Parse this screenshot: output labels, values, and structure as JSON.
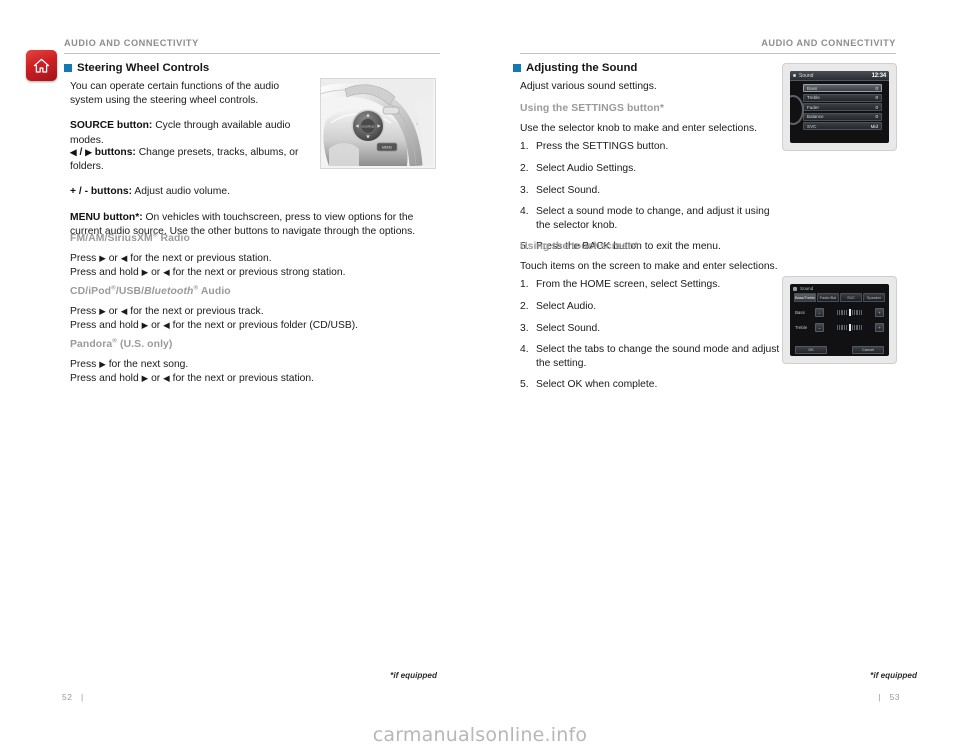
{
  "document": {
    "watermark": "carmanualsonline.info"
  },
  "left_page": {
    "header": "AUDIO AND CONNECTIVITY",
    "page_number": "52",
    "footnote": "*if equipped",
    "home_icon": "home-icon",
    "section_title": "Steering Wheel Controls",
    "intro": "You can operate certain functions of the audio system using the steering wheel controls.",
    "items": [
      {
        "label": "SOURCE button:",
        "text": " Cycle through available audio modes."
      },
      {
        "label_prefix": "",
        "label": "buttons:",
        "text": " Change presets, tracks, albums, or folders."
      },
      {
        "label": "+ / - buttons:",
        "text": " Adjust audio volume."
      },
      {
        "label": "MENU button*:",
        "text": " On vehicles with touchscreen, press to view options for the current audio source. Use the other buttons to navigate through the options."
      }
    ],
    "subsections": [
      {
        "heading": "FM/AM/SiriusXM",
        "heading_sup": "®",
        "heading_tail": " Radio",
        "lines": [
          "for the next or previous station.",
          "for the next or previous strong station."
        ]
      },
      {
        "heading": "CD/iPod",
        "heading_sup": "®",
        "heading_mid": "/USB/",
        "heading_italic": "Bluetooth",
        "heading_sup2": "®",
        "heading_tail": " Audio",
        "lines": [
          "for the next or previous track.",
          "for the next or previous folder (CD/USB)."
        ]
      },
      {
        "heading": "Pandora",
        "heading_sup": "®",
        "heading_tail": " (U.S. only)",
        "lines": [
          "for the next song.",
          "for the next or previous station."
        ]
      }
    ],
    "press_word": "Press",
    "press_hold_word": "Press and hold",
    "or_word": "or",
    "figure_wheel": "steering-wheel-controls-photo"
  },
  "right_page": {
    "header": "AUDIO AND CONNECTIVITY",
    "page_number": "53",
    "footnote": "*if equipped",
    "section_title": "Adjusting the Sound",
    "intro": "Adjust various sound settings.",
    "block_1": {
      "subhead": "Using the SETTINGS button*",
      "lead": "Use the selector knob to make and enter selections.",
      "steps": [
        "Press the SETTINGS button.",
        "Select Audio Settings.",
        "Select Sound.",
        "Select a sound mode to change, and adjust it using the selector knob.",
        "Press the BACK button to exit the menu."
      ]
    },
    "block_2": {
      "subhead": "Using the touchscreen*",
      "lead": "Touch items on the screen to make and enter selections.",
      "steps": [
        "From the HOME screen, select Settings.",
        "Select Audio.",
        "Select Sound.",
        "Select the tabs to change the sound mode and adjust the setting.",
        "Select OK when complete."
      ]
    },
    "screen_knob": {
      "title": "Sound",
      "clock": "12:34",
      "rows": [
        {
          "label": "Bass",
          "value": "0",
          "selected": true
        },
        {
          "label": "Treble",
          "value": "0",
          "selected": false
        },
        {
          "label": "Fader",
          "value": "0",
          "selected": false
        },
        {
          "label": "Balance",
          "value": "0",
          "selected": false
        },
        {
          "label": "SVC",
          "value": "Mid",
          "selected": false
        }
      ]
    },
    "screen_touch": {
      "title": "Sound",
      "tabs": [
        "Bass/Treble",
        "Fader/Bal",
        "SVC",
        "Speaker"
      ],
      "sliders": [
        {
          "label": "Bass",
          "minus": "–",
          "plus": "+"
        },
        {
          "label": "Treble",
          "minus": "–",
          "plus": "+"
        }
      ],
      "buttons": [
        "OK",
        "Cancel"
      ]
    }
  },
  "colors": {
    "bullet_blue": "#1378b4",
    "header_gray": "#8d8d8d",
    "subhead_gray": "#9a9a9a",
    "home_red": "#cf2026"
  }
}
